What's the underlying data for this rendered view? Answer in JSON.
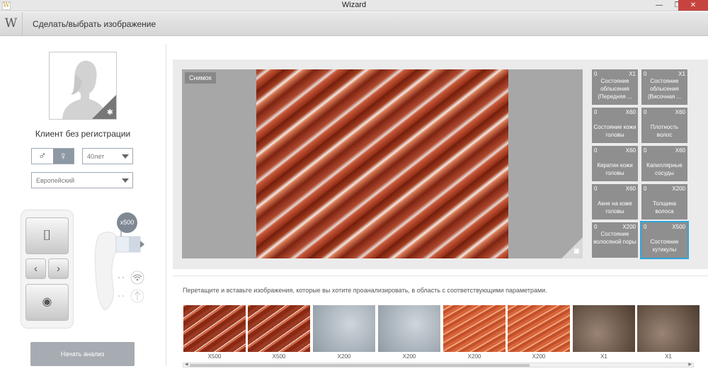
{
  "window": {
    "title": "Wizard",
    "min": "—",
    "max": "❐",
    "close": "✕"
  },
  "header": {
    "logo": "W",
    "title": "Сделать/выбрать изображение"
  },
  "client": {
    "name": "Клиент без регистрации",
    "male": "♂",
    "female": "♀",
    "age": "40лет",
    "ethnicity": "Европейский"
  },
  "device": {
    "zoom": "x500",
    "start_label": "Начать анализ"
  },
  "preview": {
    "snapshot_label": "Снимок"
  },
  "tiles": [
    {
      "n": "0",
      "z": "X1",
      "label": "Состояние облысения (Передняя ..."
    },
    {
      "n": "0",
      "z": "X1",
      "label": "Состояние облысения (Височная ..."
    },
    {
      "n": "0",
      "z": "X60",
      "label": "Состояние кожи головы"
    },
    {
      "n": "0",
      "z": "X60",
      "label": "Плотность волос"
    },
    {
      "n": "0",
      "z": "X60",
      "label": "Кератин кожи головы"
    },
    {
      "n": "0",
      "z": "X60",
      "label": "Капиллярные сосуды"
    },
    {
      "n": "0",
      "z": "X60",
      "label": "Акне на коже головы"
    },
    {
      "n": "0",
      "z": "X200",
      "label": "Толщина волоса"
    },
    {
      "n": "0",
      "z": "X200",
      "label": "Состояние волосяной поры"
    },
    {
      "n": "0",
      "z": "X500",
      "label": "Состояние кутикулы"
    }
  ],
  "instructions": "Перетащите и вставьте изображения, которые вы хотите проанализировать, в область с соответствующими параметрами.",
  "thumbnails": [
    {
      "zoom": "X500",
      "kind": "hair-red"
    },
    {
      "zoom": "X500",
      "kind": "hair-red"
    },
    {
      "zoom": "X200",
      "kind": "skin-grey"
    },
    {
      "zoom": "X200",
      "kind": "skin-grey"
    },
    {
      "zoom": "X200",
      "kind": "hair-orange"
    },
    {
      "zoom": "X200",
      "kind": "hair-orange"
    },
    {
      "zoom": "X1",
      "kind": "scalp-dark"
    },
    {
      "zoom": "X1",
      "kind": "scalp-dark"
    }
  ],
  "colors": {
    "accent": "#2fa4dc",
    "tile": "#8f8f8f",
    "button": "#a7acb2"
  }
}
